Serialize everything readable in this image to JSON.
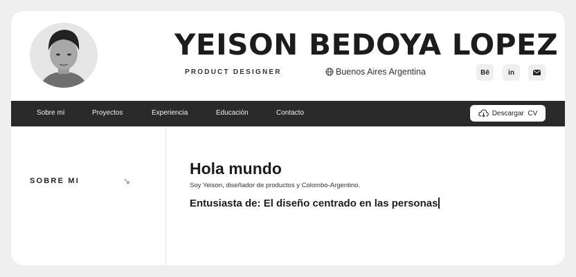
{
  "header": {
    "name": "YEISON BEDOYA LOPEZ",
    "role": "PRODUCT DESIGNER",
    "location": "Buenos Aires Argentina",
    "avatar_alt": "profile-photo"
  },
  "social": [
    {
      "label": "Bē",
      "icon": "behance-icon"
    },
    {
      "label": "in",
      "icon": "linkedin-icon"
    },
    {
      "label": "",
      "icon": "mail-icon"
    }
  ],
  "nav": {
    "items": [
      "Sobre mí",
      "Proyectos",
      "Experiencia",
      "Educación",
      "Contacto"
    ],
    "cv_button": "Descargar  CV"
  },
  "sidebar": {
    "label": "SOBRE MI",
    "arrow": "↘"
  },
  "main": {
    "heading": "Hola mundo",
    "intro": "Soy Yeison, diseñador de productos y Colombo-Argentino.",
    "enthusiast": "Entusiasta de: El diseño centrado en las personas"
  },
  "colors": {
    "nav_bg": "#2a2a2a",
    "page_bg": "#efefef",
    "card_bg": "#ffffff"
  }
}
